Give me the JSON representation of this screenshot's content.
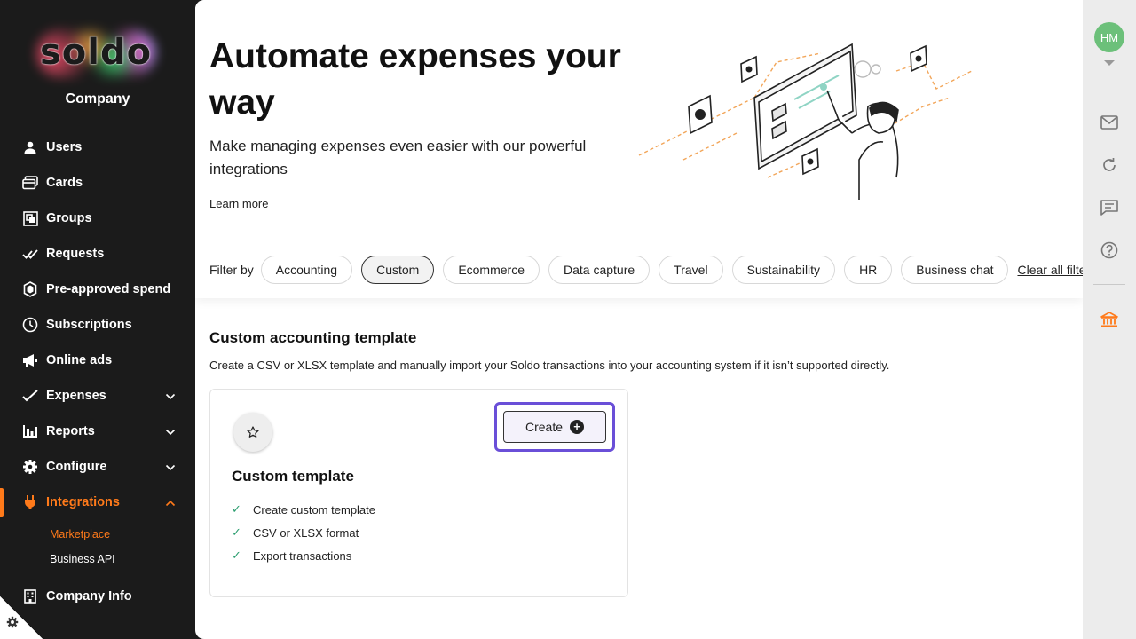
{
  "brand": {
    "logo_text": "soldo",
    "company": "Company"
  },
  "sidebar": {
    "items": [
      {
        "label": "Users",
        "icon": "user-icon"
      },
      {
        "label": "Cards",
        "icon": "cards-icon"
      },
      {
        "label": "Groups",
        "icon": "groups-icon"
      },
      {
        "label": "Requests",
        "icon": "requests-icon"
      },
      {
        "label": "Pre-approved spend",
        "icon": "shield-icon"
      },
      {
        "label": "Subscriptions",
        "icon": "clock-icon"
      },
      {
        "label": "Online ads",
        "icon": "megaphone-icon"
      },
      {
        "label": "Expenses",
        "icon": "check-icon",
        "expandable": true
      },
      {
        "label": "Reports",
        "icon": "bar-chart-icon",
        "expandable": true
      },
      {
        "label": "Configure",
        "icon": "gear-icon",
        "expandable": true
      },
      {
        "label": "Integrations",
        "icon": "plug-icon",
        "expandable": true,
        "expanded": true,
        "active": true
      }
    ],
    "subitems": [
      {
        "label": "Marketplace",
        "active": true
      },
      {
        "label": "Business API",
        "active": false
      }
    ],
    "bottom_item": {
      "label": "Company Info",
      "icon": "building-icon"
    }
  },
  "hero": {
    "title": "Automate expenses your way",
    "lead": "Make managing expenses even easier with our powerful integrations",
    "learn_more": "Learn more"
  },
  "filters": {
    "label": "Filter by",
    "chips": [
      "Accounting",
      "Custom",
      "Ecommerce",
      "Data capture",
      "Travel",
      "Sustainability",
      "HR",
      "Business chat"
    ],
    "selected": "Custom",
    "clear": "Clear all filters"
  },
  "section": {
    "title": "Custom accounting template",
    "description": "Create a CSV or XLSX template and manually import your Soldo transactions into your accounting system if it isn’t supported directly."
  },
  "card": {
    "icon": "star-icon",
    "create_label": "Create",
    "title": "Custom template",
    "features": [
      "Create custom template",
      "CSV or XLSX format",
      "Export transactions"
    ]
  },
  "rail": {
    "avatar": "HM"
  },
  "colors": {
    "accent": "#ff7a1a",
    "focus": "#6a4fd8",
    "avatar": "#6cc07a",
    "check": "#2a9d6e"
  }
}
